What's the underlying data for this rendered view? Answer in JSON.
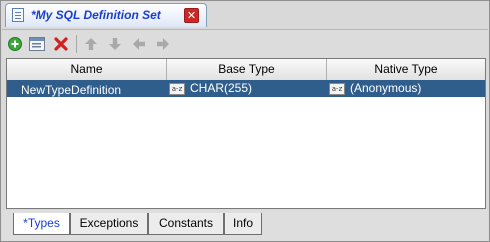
{
  "editor_tab": {
    "title": "*My SQL Definition Set",
    "icon": "document-icon",
    "close_icon": "close-icon"
  },
  "toolbar": {
    "buttons": [
      {
        "name": "add-button",
        "icon": "add-icon",
        "enabled": true
      },
      {
        "name": "edit-button",
        "icon": "edit-icon",
        "enabled": true
      },
      {
        "name": "delete-button",
        "icon": "delete-icon",
        "enabled": true
      },
      {
        "name": "move-up-button",
        "icon": "arrow-up-icon",
        "enabled": false
      },
      {
        "name": "move-down-button",
        "icon": "arrow-down-icon",
        "enabled": false
      },
      {
        "name": "move-left-button",
        "icon": "arrow-left-icon",
        "enabled": false
      },
      {
        "name": "move-right-button",
        "icon": "arrow-right-icon",
        "enabled": false
      }
    ]
  },
  "table": {
    "columns": [
      "Name",
      "Base Type",
      "Native Type"
    ],
    "rows": [
      {
        "name": "NewTypeDefinition",
        "base_type": "CHAR(255)",
        "native_type": "(Anonymous)",
        "selected": true
      }
    ],
    "type_badge": "a-z"
  },
  "bottom_tabs": [
    {
      "label": "*Types",
      "active": true
    },
    {
      "label": "Exceptions",
      "active": false
    },
    {
      "label": "Constants",
      "active": false
    },
    {
      "label": "Info",
      "active": false
    }
  ],
  "colors": {
    "selection": "#2f5e8c",
    "tab_title": "#1a3fd0",
    "add_green": "#3da53d",
    "delete_red": "#d42020",
    "disabled_gray": "#a9a9a9"
  }
}
